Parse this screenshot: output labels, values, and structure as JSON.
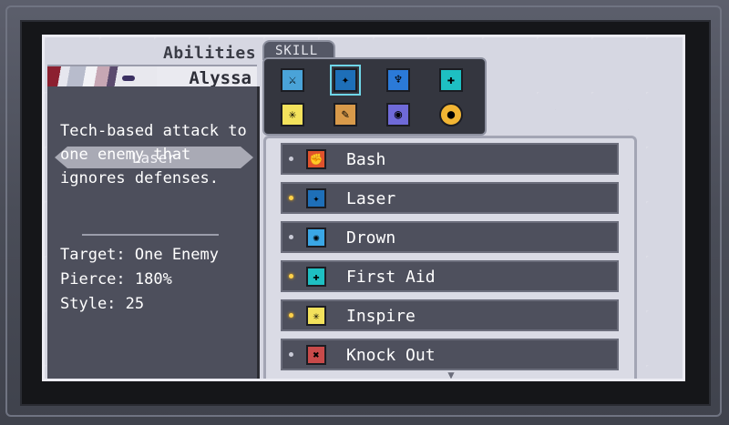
{
  "panel": {
    "title": "Abilities",
    "character_name": "Alyssa"
  },
  "selected_skill": {
    "name": "Laser",
    "description": "Tech-based attack to one enemy that ignores defenses.",
    "stats": [
      "Target: One Enemy",
      "Pierce: 180%",
      "Style: 25"
    ]
  },
  "skill_tab": {
    "label": "SKILL"
  },
  "icon_grid": [
    {
      "icon": "sword-icon",
      "color": "#4aa3d8",
      "selected": false
    },
    {
      "icon": "laser-icon",
      "color": "#1e6fb8",
      "selected": true
    },
    {
      "icon": "water-drop-icon",
      "color": "#2b7ad8",
      "selected": false
    },
    {
      "icon": "heal-cross-icon",
      "color": "#1ebfc2",
      "selected": false
    },
    {
      "icon": "inspire-star-icon",
      "color": "#f3e25c",
      "selected": false
    },
    {
      "icon": "knock-out-icon",
      "color": "#d89a4a",
      "selected": false
    },
    {
      "icon": "eye-icon",
      "color": "#6f6ad8",
      "selected": false
    },
    {
      "icon": "coin-icon",
      "color": "#f2b533",
      "selected": false
    }
  ],
  "skills": [
    {
      "label": "Bash",
      "icon": "bash-fist-icon",
      "color": "#e0522c",
      "highlighted": false
    },
    {
      "label": "Laser",
      "icon": "laser-icon",
      "color": "#1e6fb8",
      "highlighted": true
    },
    {
      "label": "Drown",
      "icon": "drown-splash-icon",
      "color": "#3aa7e6",
      "highlighted": false
    },
    {
      "label": "First Aid",
      "icon": "heal-cross-icon",
      "color": "#1ebfc2",
      "highlighted": true
    },
    {
      "label": "Inspire",
      "icon": "inspire-star-icon",
      "color": "#f3e25c",
      "highlighted": true
    },
    {
      "label": "Knock Out",
      "icon": "knock-out-icon",
      "color": "#c84a4a",
      "highlighted": false
    }
  ]
}
